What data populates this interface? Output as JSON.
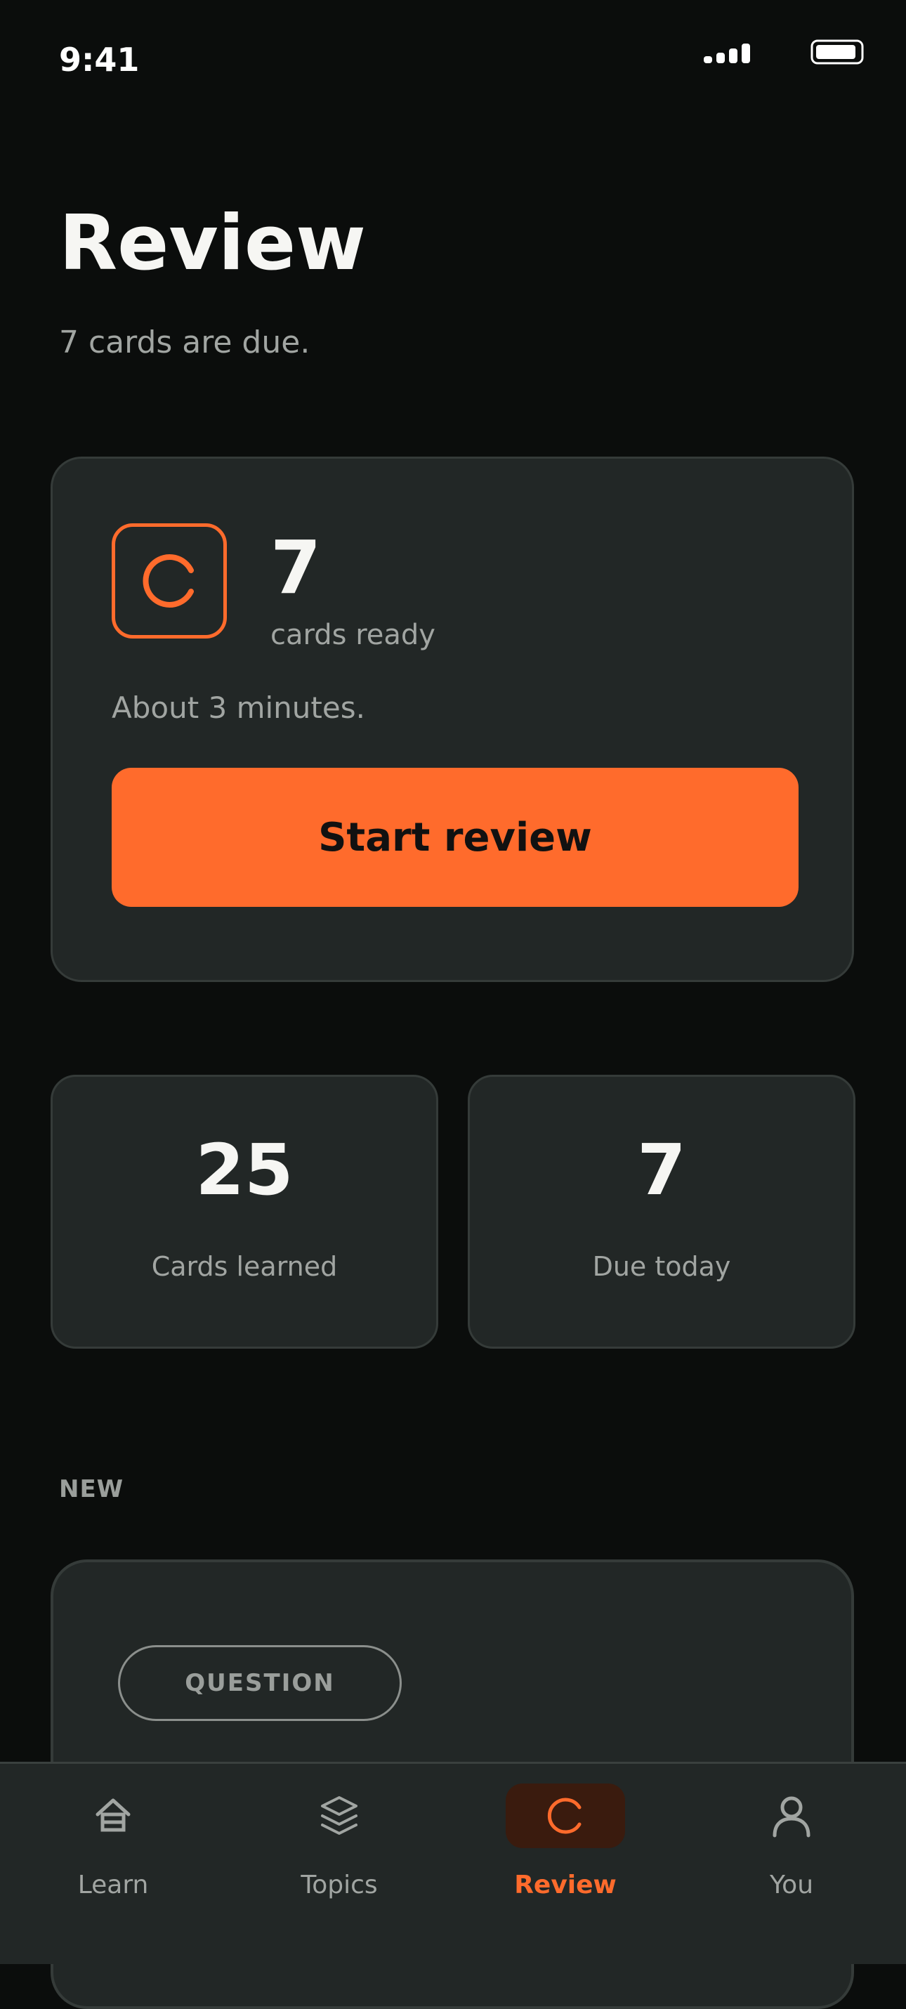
{
  "status_bar": {
    "time": "9:41"
  },
  "header": {
    "title": "Review",
    "subtitle": "7 cards are due."
  },
  "review_card": {
    "count": "7",
    "count_label": "cards ready",
    "eta": "About 3 minutes.",
    "start_label": "Start review"
  },
  "stats": [
    {
      "value": "25",
      "label": "Cards learned"
    },
    {
      "value": "7",
      "label": "Due today"
    }
  ],
  "section": {
    "label": "NEW",
    "card_tag": "QUESTION"
  },
  "tab_bar": {
    "tabs": [
      {
        "label": "Learn",
        "icon": "home-icon"
      },
      {
        "label": "Topics",
        "icon": "layers-icon"
      },
      {
        "label": "Review",
        "icon": "refresh-icon",
        "active": true
      },
      {
        "label": "You",
        "icon": "person-icon"
      }
    ]
  },
  "colors": {
    "accent": "#ff6b2c",
    "background": "#0b0d0c",
    "card": "#222726",
    "muted_text": "#a1a5a2"
  }
}
